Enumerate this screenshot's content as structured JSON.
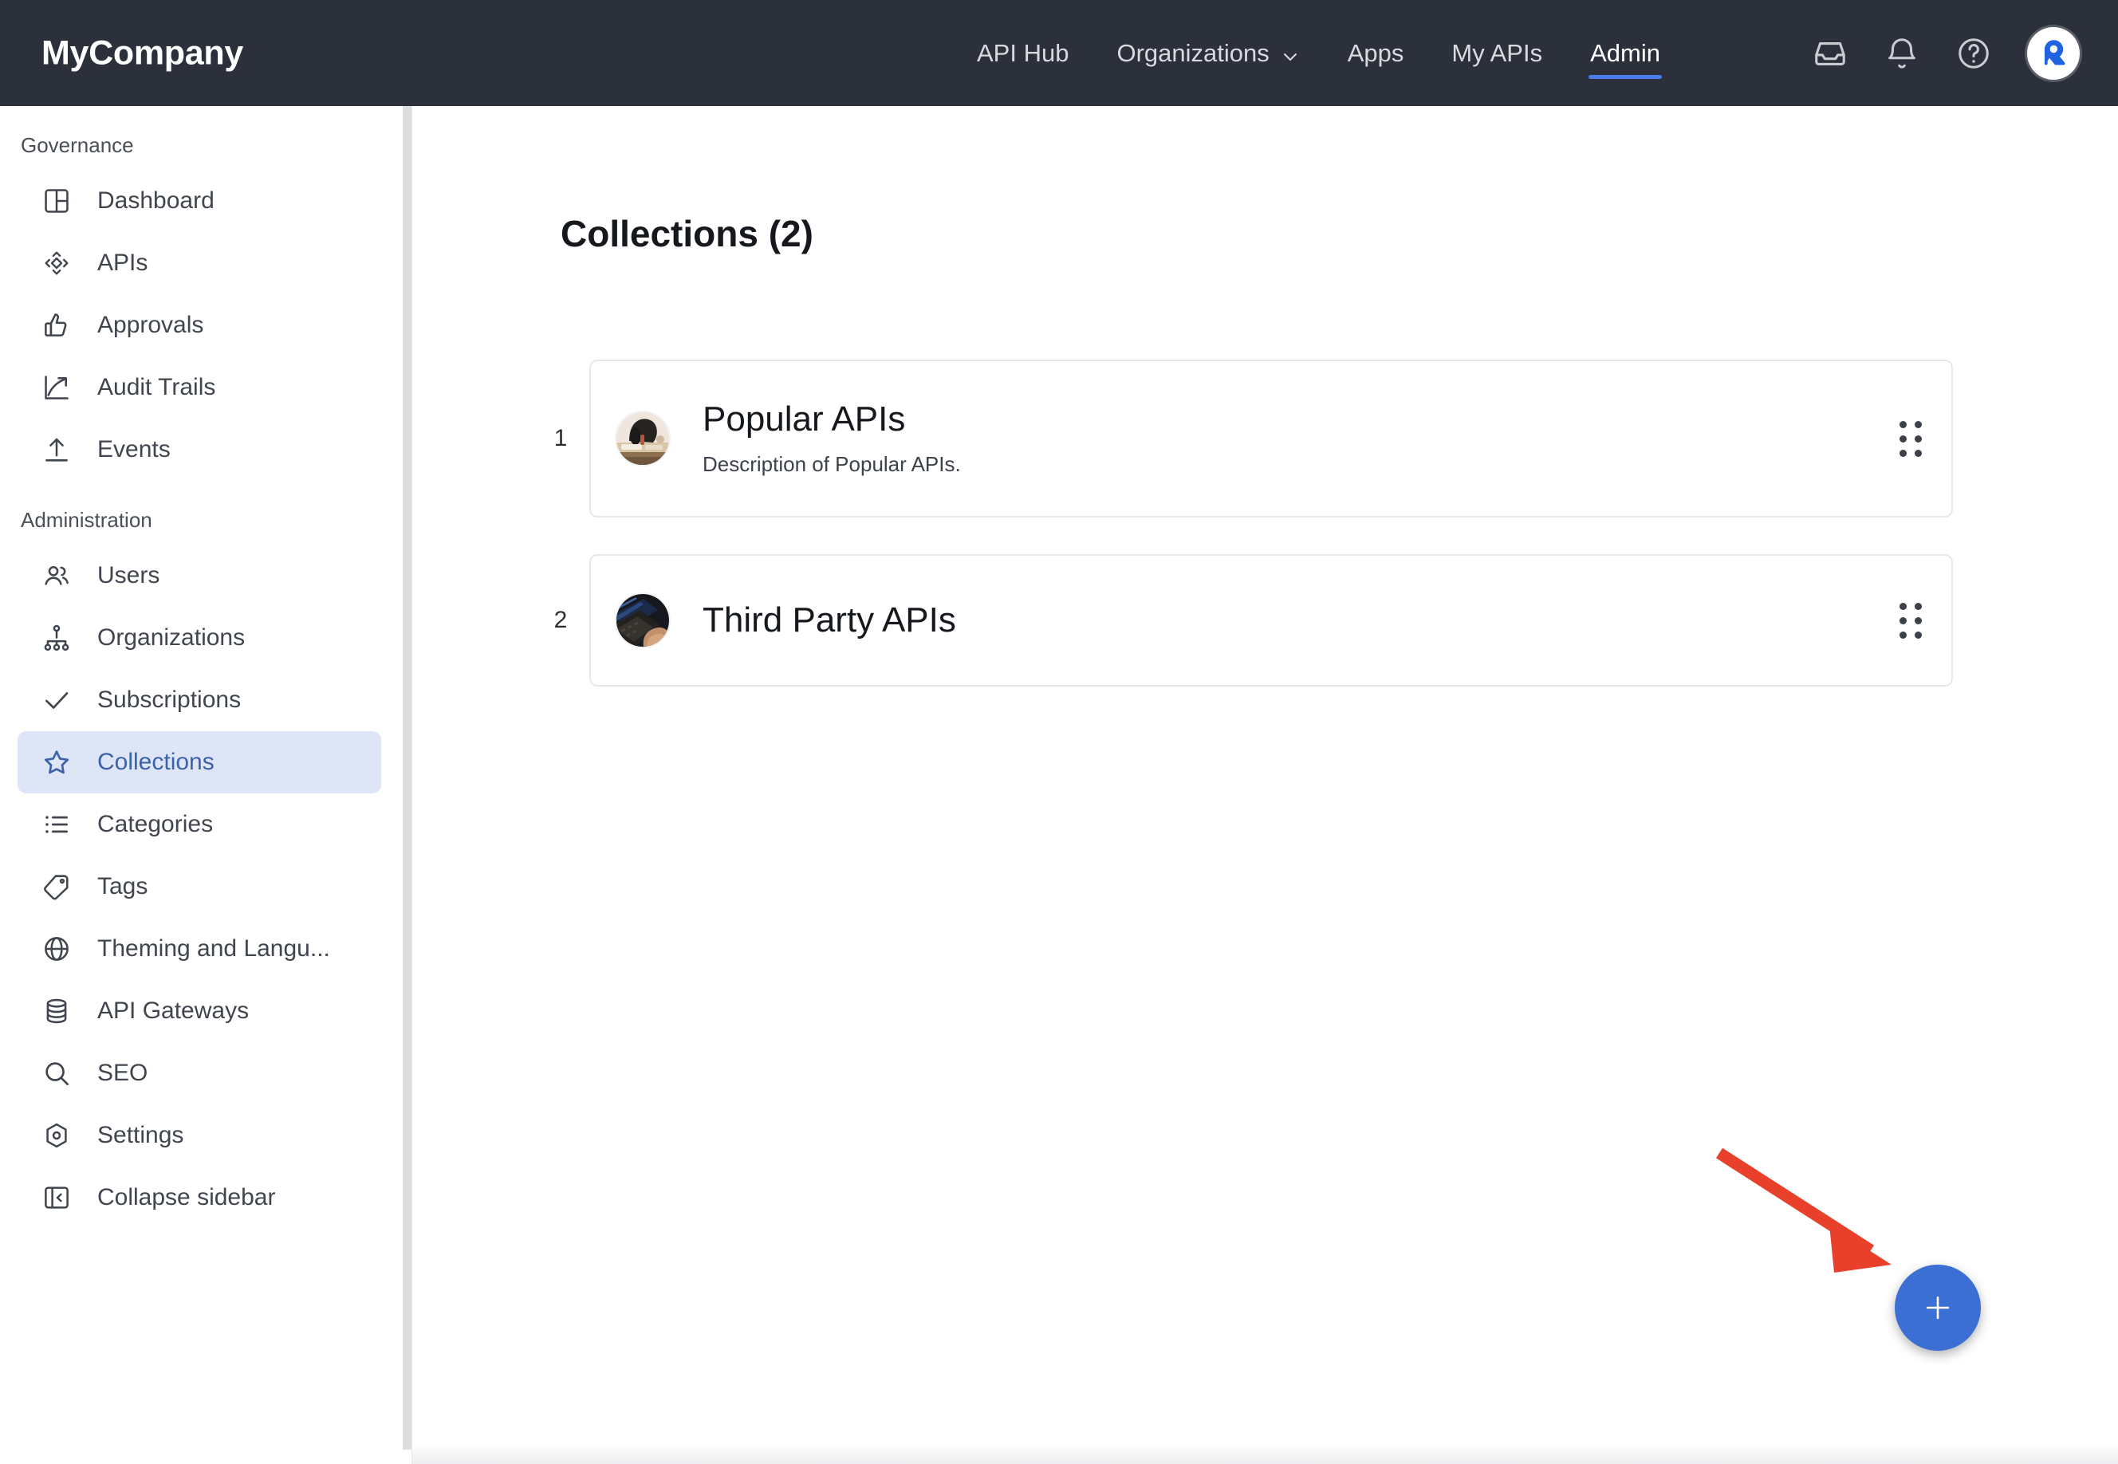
{
  "header": {
    "brand": "MyCompany",
    "nav": [
      {
        "label": "API Hub",
        "active": false,
        "has_chevron": false
      },
      {
        "label": "Organizations",
        "active": false,
        "has_chevron": true
      },
      {
        "label": "Apps",
        "active": false,
        "has_chevron": false
      },
      {
        "label": "My APIs",
        "active": false,
        "has_chevron": false
      },
      {
        "label": "Admin",
        "active": true,
        "has_chevron": false
      }
    ],
    "icons": [
      "inbox-icon",
      "bell-icon",
      "help-circle-icon"
    ],
    "avatar_letter": "R",
    "active_underline_color": "#4b7cea",
    "background_color": "#2b303b"
  },
  "sidebar": {
    "sections": [
      {
        "label": "Governance",
        "items": [
          {
            "label": "Dashboard",
            "icon": "dashboard-layout-icon",
            "active": false
          },
          {
            "label": "APIs",
            "icon": "api-diamond-icon",
            "active": false
          },
          {
            "label": "Approvals",
            "icon": "thumbs-up-icon",
            "active": false
          },
          {
            "label": "Audit Trails",
            "icon": "trending-up-icon",
            "active": false
          },
          {
            "label": "Events",
            "icon": "upload-icon",
            "active": false
          }
        ]
      },
      {
        "label": "Administration",
        "items": [
          {
            "label": "Users",
            "icon": "users-icon",
            "active": false
          },
          {
            "label": "Organizations",
            "icon": "org-tree-icon",
            "active": false
          },
          {
            "label": "Subscriptions",
            "icon": "check-icon",
            "active": false
          },
          {
            "label": "Collections",
            "icon": "star-icon",
            "active": true
          },
          {
            "label": "Categories",
            "icon": "list-icon",
            "active": false
          },
          {
            "label": "Tags",
            "icon": "tag-icon",
            "active": false
          },
          {
            "label": "Theming and Langu...",
            "icon": "globe-icon",
            "active": false
          },
          {
            "label": "API Gateways",
            "icon": "database-icon",
            "active": false
          },
          {
            "label": "SEO",
            "icon": "search-icon",
            "active": false
          },
          {
            "label": "Settings",
            "icon": "settings-hex-icon",
            "active": false
          }
        ]
      }
    ],
    "collapse": {
      "label": "Collapse sidebar",
      "icon": "collapse-sidebar-icon"
    },
    "active_bg_color": "#dde5f7",
    "active_text_color": "#3c63a8"
  },
  "main": {
    "title": "Collections (2)",
    "collections": [
      {
        "number": "1",
        "name": "Popular APIs",
        "description": "Description of Popular APIs.",
        "thumbnail": "desk-workspace-photo",
        "handle": "drag-handle-icon"
      },
      {
        "number": "2",
        "name": "Third Party APIs",
        "description": "",
        "thumbnail": "laptop-keyboard-photo",
        "handle": "drag-handle-icon"
      }
    ],
    "add_button": {
      "icon": "plus-icon",
      "color": "#3b6fd4"
    },
    "annotation": {
      "type": "arrow",
      "color": "#e8402a",
      "points_to": "add-collection-button"
    }
  }
}
